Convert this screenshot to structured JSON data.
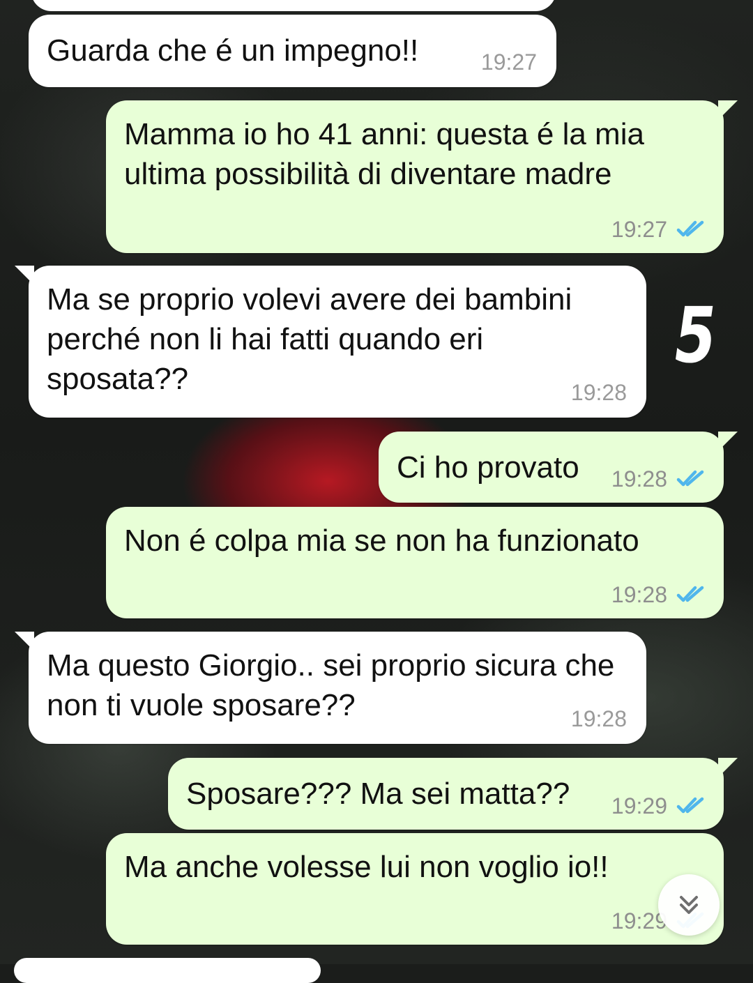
{
  "chat": {
    "messages": [
      {
        "direction": "incoming",
        "text": "Guarda che é un impegno!!",
        "time": "19:27"
      },
      {
        "direction": "outgoing",
        "text": "Mamma io ho 41 anni: questa é la mia ultima possibilità di diventare madre",
        "time": "19:27",
        "status_icon": "double-check-icon"
      },
      {
        "direction": "incoming",
        "text": "Ma se proprio volevi avere dei bambini perché non li hai fatti quando eri sposata??",
        "time": "19:28"
      },
      {
        "direction": "outgoing",
        "text": "Ci ho provato",
        "time": "19:28",
        "status_icon": "double-check-icon"
      },
      {
        "direction": "outgoing",
        "text": "Non é colpa mia se non ha funzionato",
        "time": "19:28",
        "status_icon": "double-check-icon"
      },
      {
        "direction": "incoming",
        "text": "Ma questo Giorgio.. sei proprio sicura che non ti vuole sposare??",
        "time": "19:28"
      },
      {
        "direction": "outgoing",
        "text": "Sposare??? Ma sei matta??",
        "time": "19:29",
        "status_icon": "double-check-icon"
      },
      {
        "direction": "outgoing",
        "text": "Ma anche volesse lui non voglio io!!",
        "time": "19:29",
        "status_icon": "double-check-icon"
      }
    ]
  },
  "annotation": {
    "number": "5"
  },
  "controls": {
    "scroll_down_icon": "double-chevron-down-icon"
  },
  "colors": {
    "incoming_bubble": "#ffffff",
    "outgoing_bubble": "#e8ffd7",
    "read_ticks": "#4fb6ec",
    "timestamp": "#8e8e8e",
    "wallpaper_dark": "#1b1d1b",
    "rose_red": "#be1923"
  }
}
